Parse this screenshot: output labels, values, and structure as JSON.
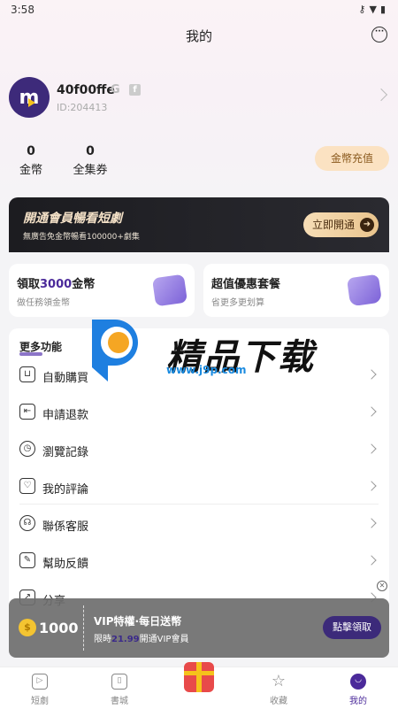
{
  "status": {
    "time": "3:58",
    "icons": [
      "key-icon",
      "wifi-icon",
      "battery-icon"
    ]
  },
  "nav": {
    "title": "我的",
    "message_icon": "message-icon"
  },
  "profile": {
    "username": "40f00ffe",
    "uid": "ID:204413"
  },
  "stats": {
    "coins_value": "0",
    "coins_label": "金幣",
    "pass_value": "0",
    "pass_label": "全集券",
    "recharge_label": "金幣充值"
  },
  "vip_banner": {
    "title": "開通會員暢看短劇",
    "subtitle": "無廣告免金幣暢看100000+劇集",
    "button": "立即開通"
  },
  "cards": [
    {
      "title_prefix": "領取",
      "title_highlight": "3000",
      "title_suffix": "金幣",
      "subtitle": "做任務領金幣"
    },
    {
      "title": "超值優惠套餐",
      "subtitle": "省更多更划算"
    }
  ],
  "more": {
    "title": "更多功能",
    "items": [
      {
        "label": "自動購買",
        "icon": "cart-icon"
      },
      {
        "label": "申請退款",
        "icon": "refund-icon"
      },
      {
        "label": "瀏覽記錄",
        "icon": "clock-icon"
      },
      {
        "label": "我的評論",
        "icon": "comment-icon"
      },
      {
        "label": "聯係客服",
        "icon": "headset-icon"
      },
      {
        "label": "幫助反饋",
        "icon": "feedback-icon"
      },
      {
        "label": "分享",
        "icon": "share-icon"
      }
    ]
  },
  "watermark": {
    "text": "精品下载",
    "url": "www.j9p.com"
  },
  "popup": {
    "coin_amount": "1000",
    "title": "VIP特權·每日送幣",
    "sub_prefix": "限時",
    "price": "21.99",
    "sub_suffix": "開通VIP會員",
    "claim": "點擊領取"
  },
  "tabs": [
    {
      "label": "短劇",
      "icon": "play-icon"
    },
    {
      "label": "書城",
      "icon": "book-icon"
    },
    {
      "label": "",
      "icon": "gift-icon"
    },
    {
      "label": "收藏",
      "icon": "star-icon"
    },
    {
      "label": "我的",
      "icon": "profile-icon"
    }
  ]
}
